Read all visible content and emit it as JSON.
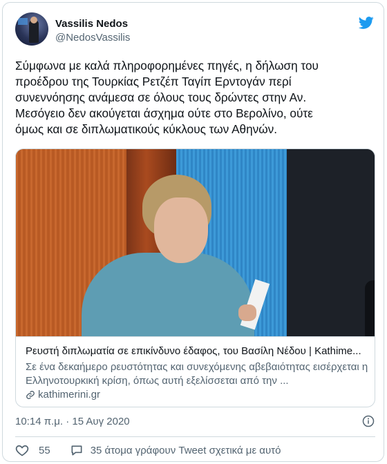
{
  "tweet": {
    "author_name": "Vassilis Nedos",
    "author_handle": "@NedosVassilis",
    "text": "Σύμφωνα με καλά πληροφορημένες πηγές, η δήλωση του\nπροέδρου της Τουρκίας Ρετζέπ Ταγίπ Ερντογάν περί\nσυνεννόησης ανάμεσα σε όλους τους δρώντες στην Αν.\nΜεσόγειο δεν ακούγεται άσχημα ούτε στο Βερολίνο, ούτε\nόμως και σε διπλωματικούς κύκλους των Αθηνών.",
    "timestamp": "10:14 π.μ. · 15 Αυγ 2020",
    "likes": "55",
    "reply_label": "35 άτομα γράφουν Tweet σχετικά με αυτό"
  },
  "link_card": {
    "title": "Ρευστή διπλωματία σε επικίνδυνο έδαφος, του Βασίλη Νέδου | Kathime...",
    "description": "Σε ένα δεκαήμερο ρευστότητας και συνεχόμενης αβεβαιότητας εισέρχεται η Ελληνοτουρκική κρίση, όπως αυτή εξελίσσεται από την ...",
    "domain": "kathimerini.gr"
  },
  "icons": {
    "brand": "twitter-bird-icon",
    "info": "info-icon",
    "like": "heart-icon",
    "reply": "speech-bubble-icon",
    "link": "link-icon"
  },
  "colors": {
    "brand_blue": "#1d9bf0",
    "text_primary": "#0f1419",
    "text_secondary": "#536471",
    "border": "#cfd9de"
  }
}
